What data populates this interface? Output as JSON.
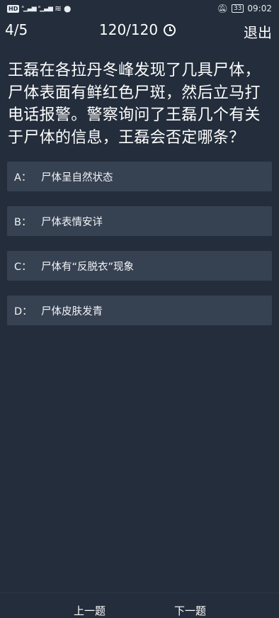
{
  "status_bar": {
    "left_icons": [
      "HD",
      "4G",
      "4G",
      "wifi",
      "wechat"
    ],
    "battery": "33",
    "time": "09:02"
  },
  "header": {
    "progress": "4/5",
    "timer": "120/120",
    "exit_label": "退出"
  },
  "question": "王磊在各拉丹冬峰发现了几具尸体，尸体表面有鲜红色尸斑，然后立马打电话报警。警察询问了王磊几个有关于尸体的信息，王磊会否定哪条？",
  "options": [
    {
      "key": "A：",
      "text": "尸体呈自然状态"
    },
    {
      "key": "B：",
      "text": "尸体表情安详"
    },
    {
      "key": "C：",
      "text": "尸体有“反脱衣”现象"
    },
    {
      "key": "D：",
      "text": "尸体皮肤发青"
    }
  ],
  "footer": {
    "prev_label": "上一题",
    "next_label": "下一题"
  },
  "colors": {
    "background": "#232d3b",
    "option_bg": "#364152",
    "text": "#ffffff"
  }
}
